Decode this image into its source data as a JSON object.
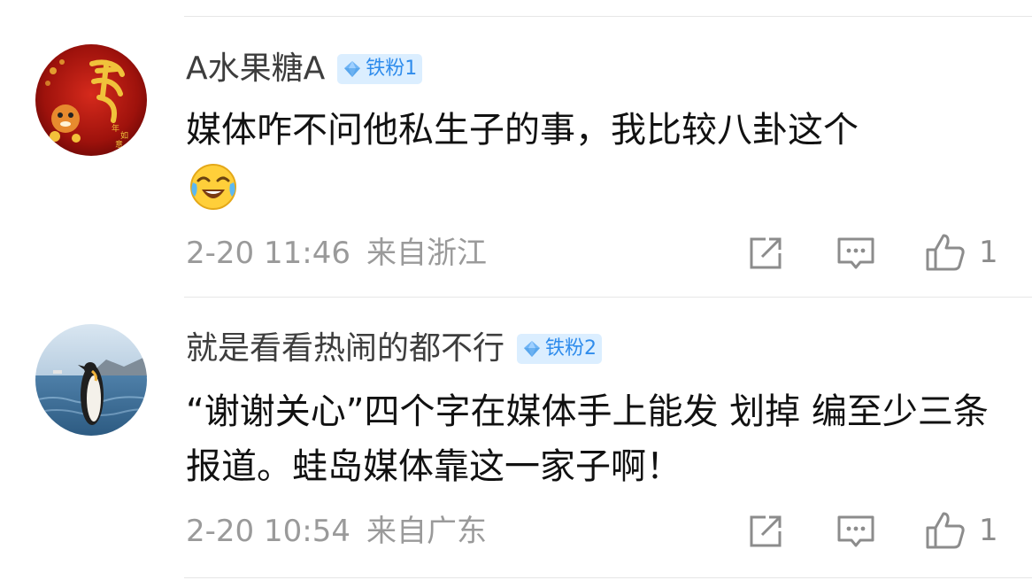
{
  "comments": [
    {
      "username": "A水果糖A",
      "badge": "铁粉1",
      "text": "媒体咋不问他私生子的事，我比较八卦这个",
      "emoji": "laugh-cry-emoji",
      "date": "2-20 11:46",
      "location": "来自浙江",
      "likes": "1"
    },
    {
      "username": "就是看看热闹的都不行",
      "badge": "铁粉2",
      "text": "“谢谢关心”四个字在媒体手上能发 划掉  编至少三条报道。蛙岛媒体靠这一家子啊！",
      "date": "2-20 10:54",
      "location": "来自广东",
      "likes": "1"
    }
  ],
  "icons": {
    "share": "share-icon",
    "comment": "comment-icon",
    "like": "thumbs-up-icon",
    "badge": "diamond-icon"
  },
  "colors": {
    "badge_bg": "#dbeeff",
    "badge_text": "#2f8cec",
    "username": "#3d3d3d",
    "meta": "#9a9a9a"
  }
}
